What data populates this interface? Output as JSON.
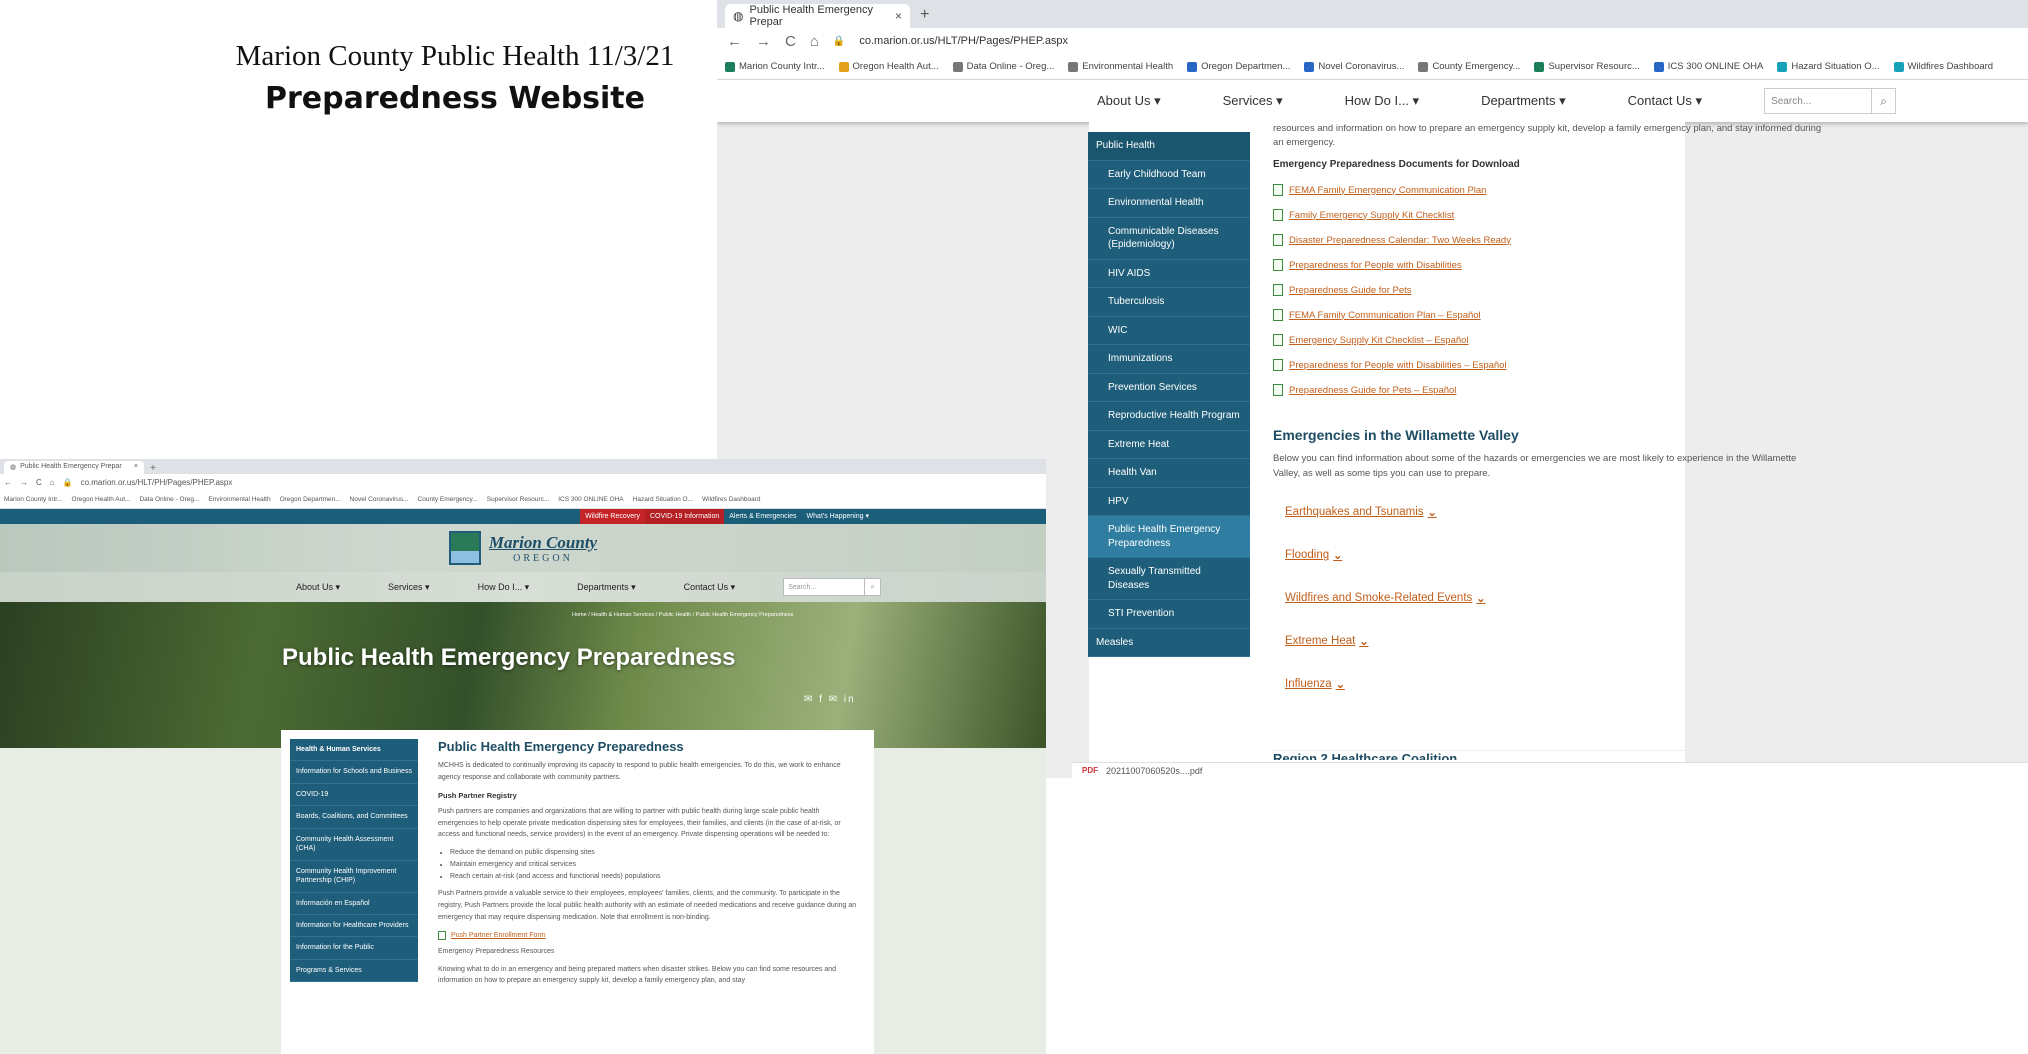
{
  "slide": {
    "title_line1": "Marion County Public Health 11/3/21",
    "title_line2": "Preparedness  Website"
  },
  "browser": {
    "tab_title": "Public Health Emergency Prepar",
    "tab_close": "×",
    "new_tab": "+",
    "url": "co.marion.or.us/HLT/PH/Pages/PHEP.aspx",
    "nav_back": "←",
    "nav_forward": "→",
    "nav_reload": "C",
    "nav_home": "⌂",
    "bookmarks": [
      {
        "label": "Marion County Intr...",
        "icon": "county-icon"
      },
      {
        "label": "Oregon Health Aut...",
        "icon": "oha-icon"
      },
      {
        "label": "Data Online - Oreg...",
        "icon": "drop-icon"
      },
      {
        "label": "Environmental Health",
        "icon": "globe-icon"
      },
      {
        "label": "Oregon Departmen...",
        "icon": "dept-icon"
      },
      {
        "label": "Novel Coronavirus...",
        "icon": "cross-icon"
      },
      {
        "label": "County Emergency...",
        "icon": "globe-icon"
      },
      {
        "label": "Supervisor Resourc...",
        "icon": "county-icon"
      },
      {
        "label": "ICS 300 ONLINE OHA",
        "icon": "ics-icon"
      },
      {
        "label": "Hazard Situation O...",
        "icon": "hazard-icon"
      },
      {
        "label": "Wildfires Dashboard",
        "icon": "wildfire-icon"
      }
    ]
  },
  "site_nav": {
    "items": [
      "About Us ▾",
      "Services ▾",
      "How Do I... ▾",
      "Departments ▾",
      "Contact Us ▾"
    ],
    "search_placeholder": "Search..."
  },
  "screenshot1": {
    "intro": "resources and information on how to prepare an emergency supply kit, develop a family emergency plan, and stay informed during an emergency.",
    "docs_heading": "Emergency Preparedness Documents for Download",
    "docs": [
      "FEMA Family Emergency Communication Plan",
      "Family Emergency Supply Kit Checklist",
      "Disaster Preparedness Calendar: Two Weeks Ready",
      "Preparedness for People with Disabilities",
      "Preparedness Guide for Pets",
      "FEMA Family Communication Plan – Español",
      "Emergency Supply Kit Checklist – Español",
      "Preparedness for People with Disabilities – Español",
      "Preparedness Guide for Pets – Español"
    ],
    "valley_heading": "Emergencies in the Willamette Valley",
    "valley_para": "Below you can find information about some of the hazards or emergencies we are most likely to experience in the Willamette Valley, as well as some tips you can use to prepare.",
    "hazards": [
      "Earthquakes and Tsunamis",
      "Flooding",
      "Wildfires and Smoke-Related Events",
      "Extreme Heat",
      "Influenza"
    ],
    "cutoff_heading": "Region 2 Healthcare Coalition",
    "sidebar": [
      "Public Health",
      "Early Childhood Team",
      "Environmental Health",
      "Communicable Diseases (Epidemiology)",
      "HIV AIDS",
      "Tuberculosis",
      "WIC",
      "Immunizations",
      "Prevention Services",
      "Reproductive Health Program",
      "Extreme Heat",
      "Health Van",
      "HPV",
      "Public Health Emergency Preparedness",
      "Sexually Transmitted Diseases",
      "STI Prevention",
      "Measles"
    ],
    "download_file": "20211007060520s....pdf",
    "download_icon_text": "PDF"
  },
  "screenshot2": {
    "utility_links": [
      "Wildfire Recovery",
      "COVID-19 Information",
      "Alerts & Emergencies",
      "What's Happening ▾"
    ],
    "logo_line1": "Marion County",
    "logo_line2": "OREGON",
    "breadcrumb": "Home / Health & Human Services / Public Health / Public Health Emergency Preparedness",
    "hero_title": "Public Health Emergency Preparedness",
    "share_icons": "✉ f ✉ in",
    "sidebar": [
      "Health & Human Services",
      "Information for Schools and Business",
      "COVID-19",
      "Boards, Coalitions, and Committees",
      "Community Health Assessment (CHA)",
      "Community Health Improvement Partnership (CHIP)",
      "Información en Español",
      "Information for Healthcare Providers",
      "Information for the Public",
      "Programs & Services"
    ],
    "page_title": "Public Health Emergency Preparedness",
    "intro": "MCHHS is dedicated to continually improving its capacity to respond to public health emergencies. To do this, we work to enhance agency response and collaborate with community partners.",
    "push_heading": "Push Partner Registry",
    "push_para": "Push partners are companies and organizations that are willing to partner with public health during large scale public health emergencies to help operate private medication dispensing sites for employees, their families, and clients (in the case of at-risk, or access and functional needs, service providers) in the event of an emergency. Private dispensing operations will be needed to:",
    "bullets": [
      "Reduce the demand on public dispensing sites",
      "Maintain emergency and critical services",
      "Reach certain at-risk (and access and functional needs) populations"
    ],
    "push_para2": "Push Partners provide a valuable service to their employees, employees' families, clients, and the community. To participate in the registry, Push Partners provide the local public health authority with an estimate of needed medications and receive guidance during an emergency that may require dispensing medication. Note that enrollment is non-binding.",
    "enroll_link": "Push Partner Enrollment Form",
    "resources_heading": "Emergency Preparedness Resources",
    "resources_para": "Knowing what to do in an emergency and being prepared matters when disaster strikes. Below you can find some resources and information on how to prepare an emergency supply kit, develop a family emergency plan, and stay"
  }
}
